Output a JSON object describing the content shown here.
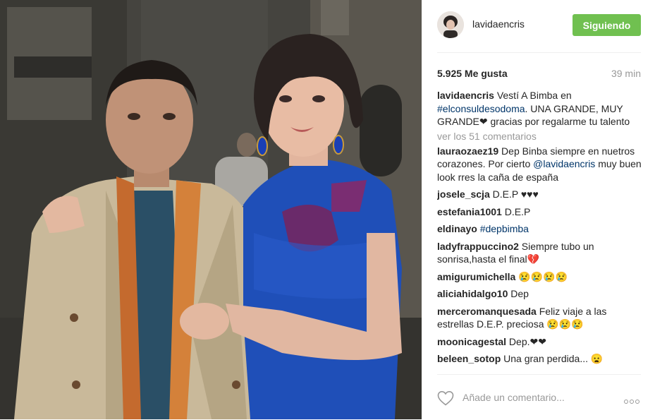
{
  "post": {
    "photo_alt": "",
    "username": "lavidaencris",
    "follow_label": "Siguiendo",
    "likes": "5.925 Me gusta",
    "time": "39 min",
    "view_comments": "ver los 51 comentarios",
    "add_comment_placeholder": "Añade un comentario...",
    "caption": {
      "user": "lavidaencris",
      "text1": " Vestí A Bimba en ",
      "tag": "#elconsuldesodoma",
      "text2": ". UNA GRANDE, MUY GRANDE❤ gracias por regalarme tu talento"
    },
    "comments": [
      {
        "user": "laurao­zaez19",
        "pre": " Dep Binba siempre en nuetros corazones. Por cierto ",
        "tag": "@lavidaencris",
        "post": " muy buen look rres la caña de españa"
      },
      {
        "user": "josele_scja",
        "pre": " D.E.P ♥♥♥",
        "tag": "",
        "post": ""
      },
      {
        "user": "estefania1001",
        "pre": " D.E.P",
        "tag": "",
        "post": ""
      },
      {
        "user": "eldinayo",
        "pre": " ",
        "tag": "#depbimba",
        "post": ""
      },
      {
        "user": "ladyfrappuccino2",
        "pre": " Siempre tubo un sonrisa,hasta el final💔",
        "tag": "",
        "post": ""
      },
      {
        "user": "amigurumichella",
        "pre": " 😢😢😢😢",
        "tag": "",
        "post": ""
      },
      {
        "user": "aliciahidalgo10",
        "pre": " Dep",
        "tag": "",
        "post": ""
      },
      {
        "user": "merceromanquesada",
        "pre": " Feliz viaje a las estrellas D.E.P. preciosa 😢😢😢",
        "tag": "",
        "post": ""
      },
      {
        "user": "moonicagestal",
        "pre": " Dep.❤❤",
        "tag": "",
        "post": ""
      },
      {
        "user": "beleen_sotop",
        "pre": " Una gran perdida... 😦",
        "tag": "",
        "post": ""
      }
    ]
  },
  "colors": {
    "follow_button": "#70c050",
    "link": "#003569",
    "muted": "#999999"
  },
  "icons": [
    "heart-icon",
    "more-options-icon"
  ]
}
